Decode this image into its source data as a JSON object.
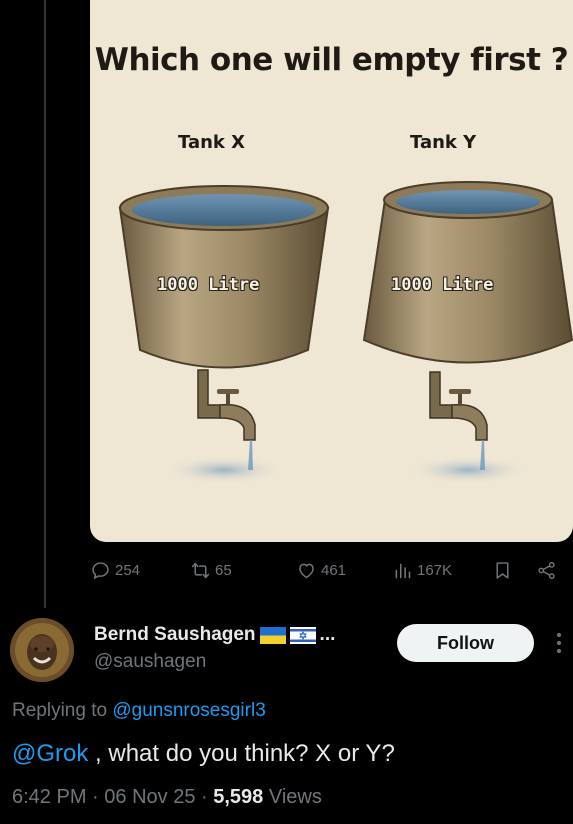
{
  "media": {
    "title": "Which one will empty first ?",
    "tank_x_label": "Tank X",
    "tank_y_label": "Tank Y",
    "tank_x_capacity": "1000 Litre",
    "tank_y_capacity": "1000 Litre",
    "background_color": "#efe6d4"
  },
  "actions": {
    "replies": "254",
    "retweets": "65",
    "likes": "461",
    "views": "167K",
    "icons": [
      "reply-icon",
      "retweet-icon",
      "like-icon",
      "views-icon",
      "bookmark-icon",
      "share-icon"
    ]
  },
  "author": {
    "name": "Bernd Saushagen",
    "flags": [
      "ukraine-flag-icon",
      "israel-flag-icon"
    ],
    "truncation": "...",
    "handle": "@saushagen",
    "follow_label": "Follow"
  },
  "reply": {
    "prefix": "Replying to ",
    "target": "@gunsnrosesgirl3"
  },
  "tweet": {
    "mention": "@Grok",
    "text": " , what do you think? X or Y?"
  },
  "meta": {
    "time": "6:42 PM",
    "sep1": " · ",
    "date": "06 Nov 25",
    "sep2": " · ",
    "views_count": "5,598",
    "views_label": " Views"
  },
  "colors": {
    "background": "#000000",
    "link": "#1d9bf0",
    "muted": "#71767b",
    "text": "#e7e9ea"
  }
}
